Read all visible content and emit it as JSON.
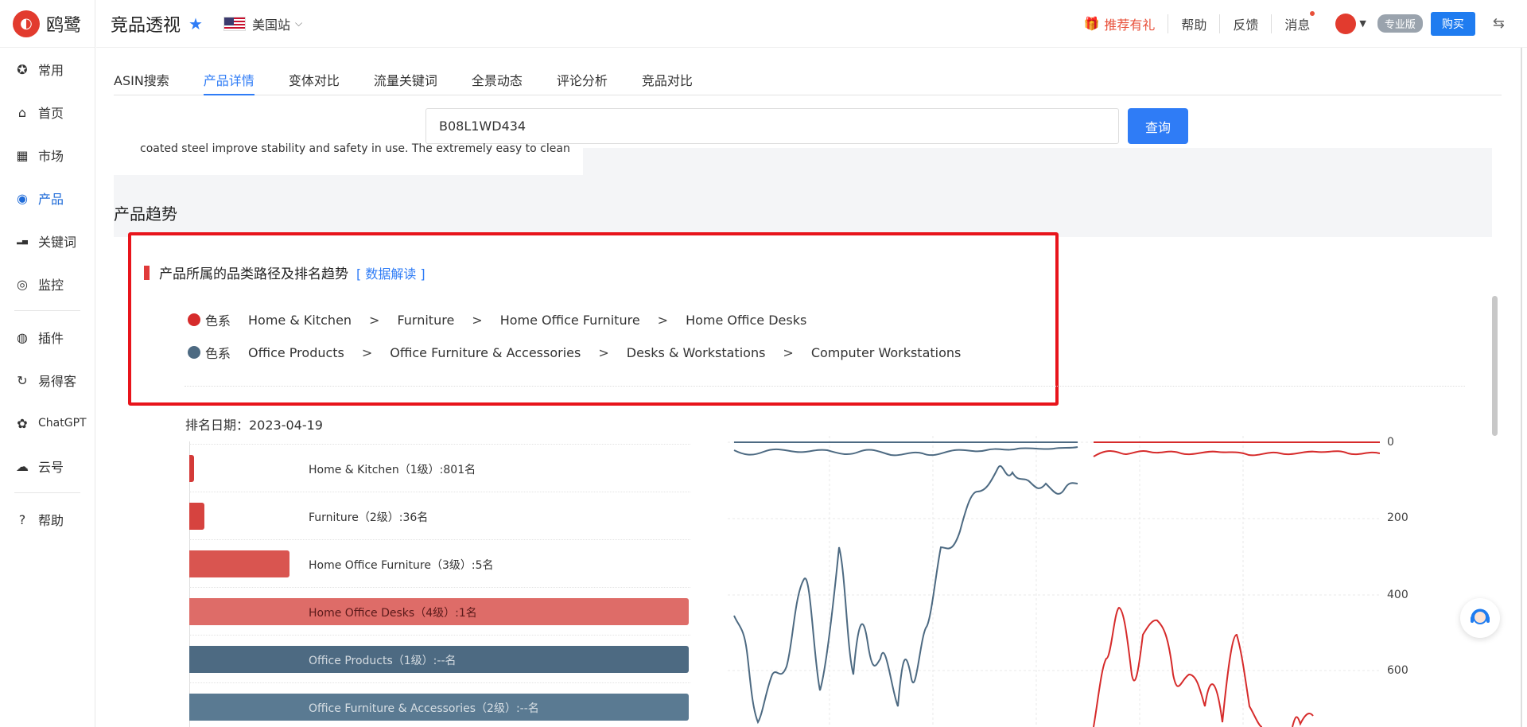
{
  "app": {
    "logo_text": "鸥鹭"
  },
  "sidebar": {
    "items": [
      {
        "label": "常用",
        "icon": "star-circle-icon"
      },
      {
        "label": "首页",
        "icon": "home-icon"
      },
      {
        "label": "市场",
        "icon": "grid-icon"
      },
      {
        "label": "产品",
        "icon": "eye-icon"
      },
      {
        "label": "关键词",
        "icon": "bar-chart-icon"
      },
      {
        "label": "监控",
        "icon": "camera-icon"
      },
      {
        "label": "插件",
        "icon": "chrome-icon"
      },
      {
        "label": "易得客",
        "icon": "swirl-icon"
      },
      {
        "label": "ChatGPT",
        "icon": "openai-icon"
      },
      {
        "label": "云号",
        "icon": "cloud-icon"
      },
      {
        "label": "帮助",
        "icon": "help-icon"
      }
    ]
  },
  "header": {
    "title": "竞品透视",
    "site": "美国站",
    "promo": "推荐有礼",
    "help": "帮助",
    "feedback": "反馈",
    "messages": "消息",
    "plan": "专业版",
    "buy": "购买"
  },
  "tabs": [
    "ASIN搜索",
    "产品详情",
    "变体对比",
    "流量关键词",
    "全景动态",
    "评论分析",
    "竞品对比"
  ],
  "search": {
    "value": "B08L1WD434",
    "button": "查询"
  },
  "truncated_text": "coated steel improve stability and safety in use. The extremely easy to clean",
  "section_title": "产品趋势",
  "card": {
    "title": "产品所属的品类路径及排名趋势",
    "link": "[ 数据解读 ]",
    "paths": [
      {
        "color": "#d62b2b",
        "tag": "色系",
        "segments": [
          "Home & Kitchen",
          "Furniture",
          "Home Office Furniture",
          "Home Office Desks"
        ]
      },
      {
        "color": "#4d6a82",
        "tag": "色系",
        "segments": [
          "Office Products",
          "Office Furniture & Accessories",
          "Desks & Workstations",
          "Computer Workstations"
        ]
      }
    ],
    "separator": ">"
  },
  "rank_date": "排名日期：2023-04-19",
  "rank_bars": [
    {
      "label": "Home & Kitchen（1级）:801名",
      "fraction": 0.01,
      "color": "#d43a38"
    },
    {
      "label": "Furniture（2级）:36名",
      "fraction": 0.03,
      "color": "#d6433f"
    },
    {
      "label": "Home Office Furniture（3级）:5名",
      "fraction": 0.2,
      "color": "#d95550"
    },
    {
      "label": "Home Office Desks（4级）:1名",
      "fraction": 1.0,
      "color": "#de6c68"
    },
    {
      "label": "Office Products（1级）:--名",
      "fraction": 1.0,
      "color": "#4d6a82"
    },
    {
      "label": "Office Furniture & Accessories（2级）:--名",
      "fraction": 1.0,
      "color": "#5a7a92"
    }
  ],
  "y_ticks": [
    "0",
    "200",
    "400",
    "600"
  ],
  "colors": {
    "accent": "#2f7cf6",
    "red": "#e8141b",
    "series_red": "#d62b2b",
    "series_blue": "#4d6a82"
  }
}
